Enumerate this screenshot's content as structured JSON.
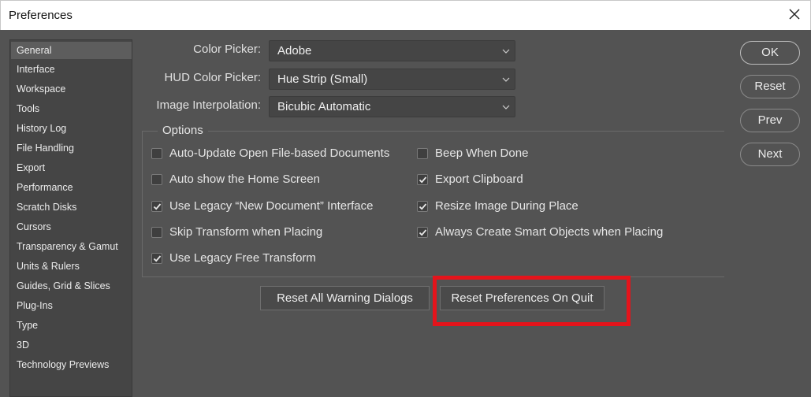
{
  "window": {
    "title": "Preferences"
  },
  "sidebar": {
    "items": [
      {
        "label": "General"
      },
      {
        "label": "Interface"
      },
      {
        "label": "Workspace"
      },
      {
        "label": "Tools"
      },
      {
        "label": "History Log"
      },
      {
        "label": "File Handling"
      },
      {
        "label": "Export"
      },
      {
        "label": "Performance"
      },
      {
        "label": "Scratch Disks"
      },
      {
        "label": "Cursors"
      },
      {
        "label": "Transparency & Gamut"
      },
      {
        "label": "Units & Rulers"
      },
      {
        "label": "Guides, Grid & Slices"
      },
      {
        "label": "Plug-Ins"
      },
      {
        "label": "Type"
      },
      {
        "label": "3D"
      },
      {
        "label": "Technology Previews"
      }
    ],
    "active": "General"
  },
  "pickers": {
    "color_picker": {
      "label": "Color Picker:",
      "value": "Adobe"
    },
    "hud_color_picker": {
      "label": "HUD Color Picker:",
      "value": "Hue Strip (Small)"
    },
    "image_interpolation": {
      "label": "Image Interpolation:",
      "value": "Bicubic Automatic"
    }
  },
  "options": {
    "legend": "Options",
    "left": [
      {
        "label": "Auto-Update Open File-based Documents",
        "checked": false
      },
      {
        "label": "Auto show the Home Screen",
        "checked": false
      },
      {
        "label": "Use Legacy “New Document” Interface",
        "checked": true
      },
      {
        "label": "Skip Transform when Placing",
        "checked": false
      },
      {
        "label": "Use Legacy Free Transform",
        "checked": true
      }
    ],
    "right": [
      {
        "label": "Beep When Done",
        "checked": false
      },
      {
        "label": "Export Clipboard",
        "checked": true
      },
      {
        "label": "Resize Image During Place",
        "checked": true
      },
      {
        "label": "Always Create Smart Objects when Placing",
        "checked": true
      }
    ]
  },
  "buttons": {
    "reset_warnings": "Reset All Warning Dialogs",
    "reset_prefs": "Reset Preferences On Quit",
    "ok": "OK",
    "reset": "Reset",
    "prev": "Prev",
    "next": "Next"
  },
  "colors": {
    "background": "#535353",
    "sidebar": "#454545",
    "highlight": "#e4141b"
  },
  "icons": {
    "close": "close-icon",
    "chevron": "chevron-down-icon",
    "check": "checkmark-icon"
  }
}
